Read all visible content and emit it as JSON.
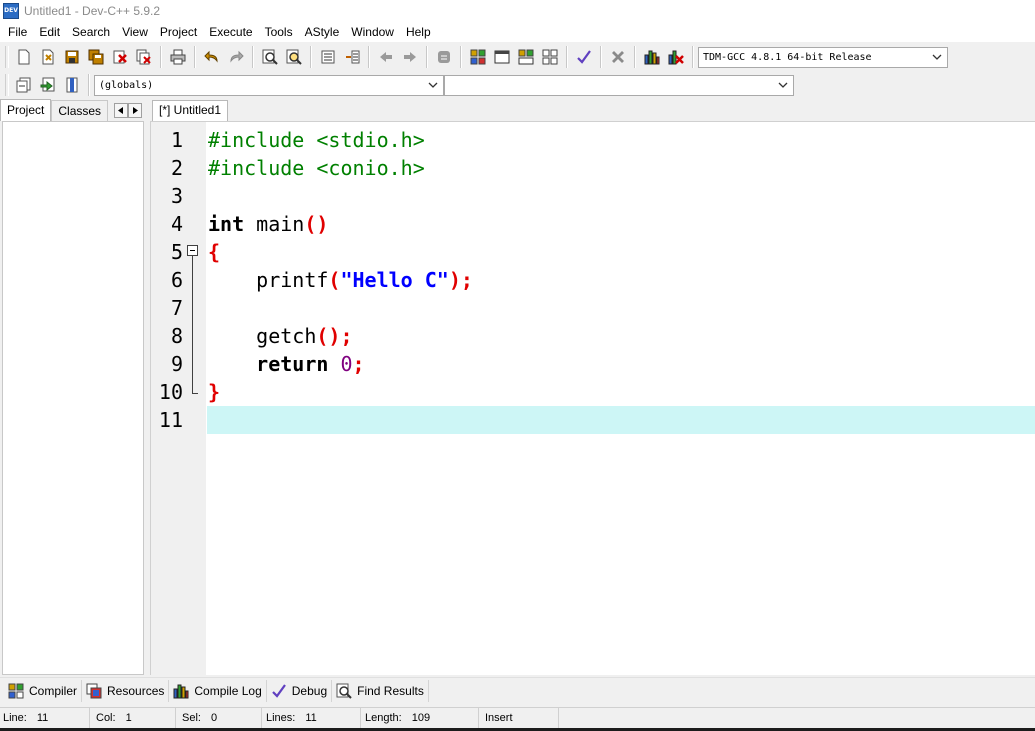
{
  "window": {
    "title": "Untitled1 - Dev-C++ 5.9.2",
    "icon_text": "DEV"
  },
  "menu": [
    "File",
    "Edit",
    "Search",
    "View",
    "Project",
    "Execute",
    "Tools",
    "AStyle",
    "Window",
    "Help"
  ],
  "toolbar": {
    "compiler_select": "TDM-GCC 4.8.1 64-bit Release",
    "scope_select": "(globals)",
    "function_select": ""
  },
  "left_panel": {
    "tabs": [
      "Project",
      "Classes"
    ]
  },
  "editor": {
    "tab_label": "[*] Untitled1",
    "line_numbers": [
      "1",
      "2",
      "3",
      "4",
      "5",
      "6",
      "7",
      "8",
      "9",
      "10",
      "11"
    ]
  },
  "bottom_tabs": [
    "Compiler",
    "Resources",
    "Compile Log",
    "Debug",
    "Find Results"
  ],
  "status": {
    "line_label": "Line:",
    "line_value": "11",
    "col_label": "Col:",
    "col_value": "1",
    "sel_label": "Sel:",
    "sel_value": "0",
    "lines_label": "Lines:",
    "lines_value": "11",
    "length_label": "Length:",
    "length_value": "109",
    "mode": "Insert"
  },
  "colors": {
    "current_line": "#cdf6f6",
    "preprocessor": "#008000",
    "symbol": "#e00000",
    "string": "#0000ff",
    "number": "#800080"
  }
}
